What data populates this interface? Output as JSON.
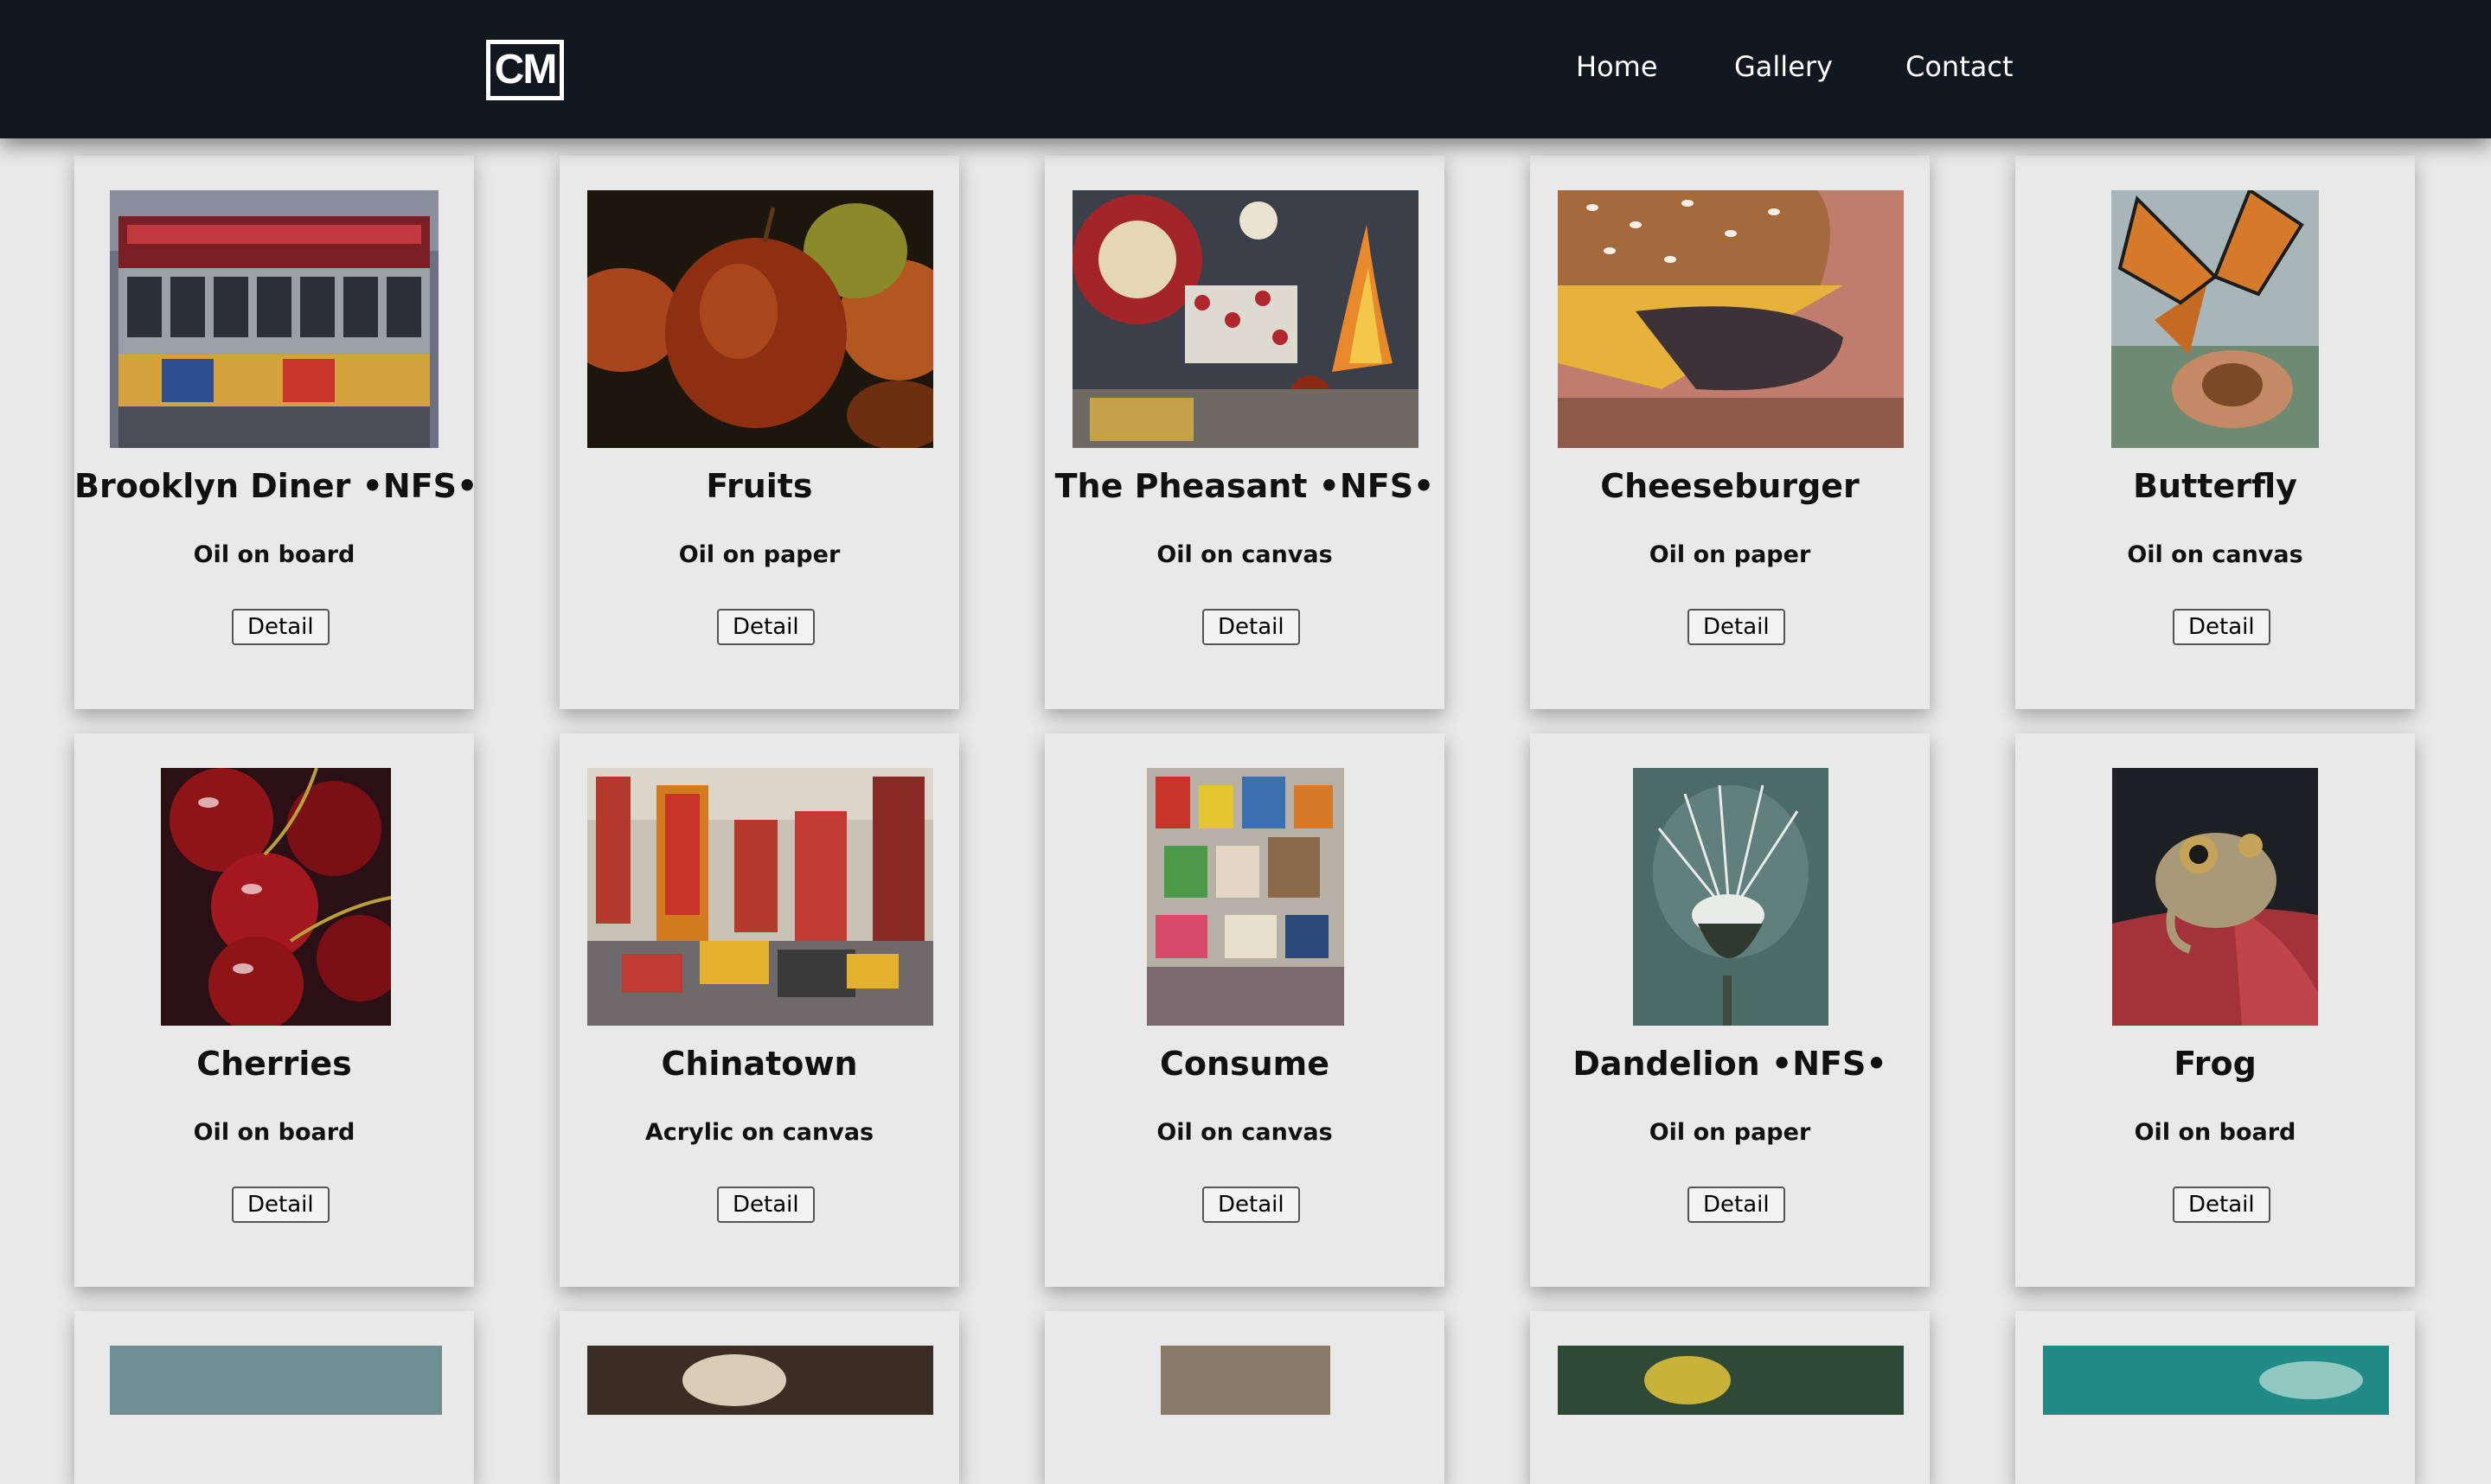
{
  "nav": {
    "logo": "CM",
    "links": [
      "Home",
      "Gallery",
      "Contact"
    ]
  },
  "artworks": [
    {
      "title": "Brooklyn Diner •NFS•",
      "medium": "Oil on board",
      "button": "Detail"
    },
    {
      "title": "Fruits",
      "medium": "Oil on paper",
      "button": "Detail"
    },
    {
      "title": "The Pheasant •NFS•",
      "medium": "Oil on canvas",
      "button": "Detail"
    },
    {
      "title": "Cheeseburger",
      "medium": "Oil on paper",
      "button": "Detail"
    },
    {
      "title": "Butterfly",
      "medium": "Oil on canvas",
      "button": "Detail"
    },
    {
      "title": "Cherries",
      "medium": "Oil on board",
      "button": "Detail"
    },
    {
      "title": "Chinatown",
      "medium": "Acrylic on canvas",
      "button": "Detail"
    },
    {
      "title": "Consume",
      "medium": "Oil on canvas",
      "button": "Detail"
    },
    {
      "title": "Dandelion •NFS•",
      "medium": "Oil on paper",
      "button": "Detail"
    },
    {
      "title": "Frog",
      "medium": "Oil on board",
      "button": "Detail"
    }
  ],
  "colors": {
    "navbar": "#121820",
    "page_background": "#e9e9e9",
    "card_background": "#e9e9e9"
  }
}
